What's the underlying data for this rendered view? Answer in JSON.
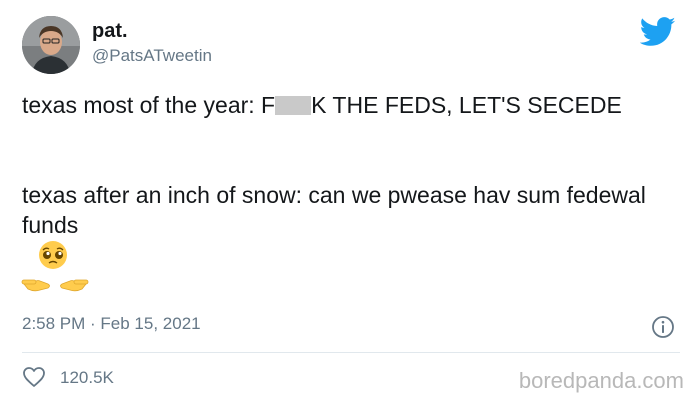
{
  "author": {
    "display_name": "pat.",
    "handle": "@PatsATweetin"
  },
  "tweet": {
    "line1_before_censor": "texas most of the year: F",
    "line1_after_censor": "K THE FEDS, LET'S SECEDE",
    "line2": "texas after an inch of snow: can we pwease hav sum fedewal funds",
    "emoji": [
      "pleading-face",
      "pointing-fingers"
    ],
    "timestamp": "2:58 PM · Feb 15, 2021"
  },
  "stats": {
    "likes": "120.5K"
  },
  "watermark": "boredpanda.com",
  "colors": {
    "twitter_blue": "#1da1f2",
    "secondary_text": "#657786",
    "censor_bar": "#c9c9c9"
  },
  "icons": [
    "twitter-bird-icon",
    "info-icon",
    "heart-icon"
  ]
}
